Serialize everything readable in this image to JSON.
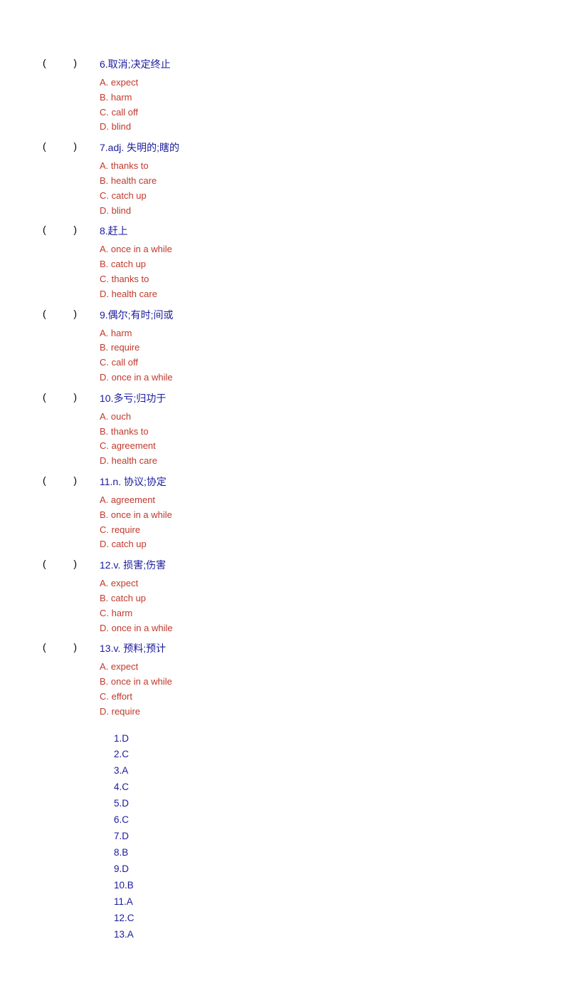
{
  "questions": [
    {
      "id": "6",
      "prefix": ")",
      "text": "6.取消;决定终止",
      "options": [
        "A. expect",
        "B. harm",
        "C. call off",
        "D. blind"
      ]
    },
    {
      "id": "7",
      "prefix": ")",
      "text": "7.adj.  失明的;瞎的",
      "options": [
        "A. thanks to",
        "B. health care",
        "C. catch up",
        "D. blind"
      ]
    },
    {
      "id": "8",
      "prefix": ")",
      "text": "8.赶上",
      "options": [
        "A. once in a while",
        "B. catch up",
        "C. thanks to",
        "D. health care"
      ]
    },
    {
      "id": "9",
      "prefix": ")",
      "text": "9.偶尔;有时;间或",
      "options": [
        "A. harm",
        "B. require",
        "C. call off",
        "D. once in a while"
      ]
    },
    {
      "id": "10",
      "prefix": ")",
      "text": "10.多亏;归功于",
      "options": [
        "A. ouch",
        "B. thanks to",
        "C. agreement",
        "D. health care"
      ]
    },
    {
      "id": "11",
      "prefix": ")",
      "text": "11.n.  协议;协定",
      "options": [
        "A. agreement",
        "B. once in a while",
        "C. require",
        "D. catch up"
      ]
    },
    {
      "id": "12",
      "prefix": ")",
      "text": "12.v.  损害;伤害",
      "options": [
        "A. expect",
        "B. catch up",
        "C. harm",
        "D. once in a while"
      ]
    },
    {
      "id": "13",
      "prefix": ")",
      "text": "13.v.  预料;预计",
      "options": [
        "A. expect",
        "B. once in a while",
        "C. effort",
        "D. require"
      ]
    }
  ],
  "answers": [
    "1.D",
    "2.C",
    "3.A",
    "4.C",
    "5.D",
    "6.C",
    "7.D",
    "8.B",
    "9.D",
    "10.B",
    "11.A",
    "12.C",
    "13.A"
  ]
}
